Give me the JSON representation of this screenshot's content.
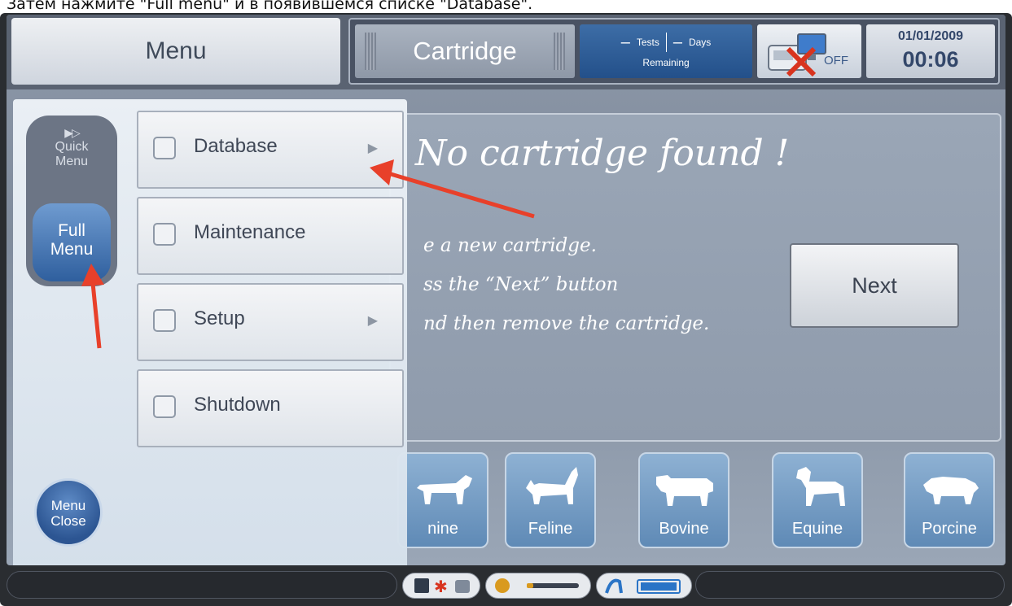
{
  "caption": "Затем нажмите \"Full menu\" и в появившемся списке \"Database\".",
  "topbar": {
    "menu_label": "Menu",
    "cartridge_label": "Cartridge",
    "tests_dash": "–",
    "tests_label": "Tests",
    "days_dash": "–",
    "days_label": "Days",
    "remaining_label": "Remaining",
    "instrument_status": "OFF",
    "date": "01/01/2009",
    "time": "00:06"
  },
  "panel": {
    "title": "No cartridge found !",
    "line1": "e a new cartridge.",
    "line2": "ss the “Next” button",
    "line3": "nd then remove the cartridge.",
    "next_label": "Next"
  },
  "species": [
    {
      "label": "nine"
    },
    {
      "label": "Feline"
    },
    {
      "label": "Bovine"
    },
    {
      "label": "Equine"
    },
    {
      "label": "Porcine"
    }
  ],
  "menu": {
    "quick_arrows": "▶▷",
    "quick_line1": "Quick",
    "quick_line2": "Menu",
    "full_line1": "Full",
    "full_line2": "Menu",
    "items": [
      {
        "label": "Database",
        "arrow": "▶"
      },
      {
        "label": "Maintenance",
        "arrow": ""
      },
      {
        "label": "Setup",
        "arrow": "▶"
      },
      {
        "label": "Shutdown",
        "arrow": ""
      }
    ],
    "close_line1": "Menu",
    "close_line2": "Close"
  },
  "colors": {
    "annotation_arrow": "#e8402a",
    "accent_blue": "#2f5f9e",
    "screen_bg": "#8f9bac"
  },
  "icons": [
    "printer-icon",
    "asterisk-icon",
    "disk-icon",
    "speaker-icon",
    "plug-icon",
    "battery-icon",
    "instrument-icon",
    "cat-icon",
    "cow-icon",
    "horse-icon",
    "pig-icon",
    "dog-icon"
  ]
}
